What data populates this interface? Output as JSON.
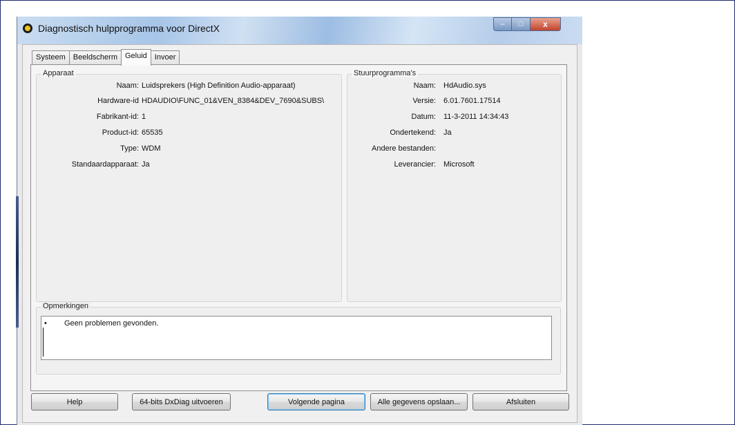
{
  "window": {
    "title": "Diagnostisch hulpprogramma voor DirectX",
    "caption_min": "–",
    "caption_max": "□",
    "caption_close": "x"
  },
  "tabs": [
    "Systeem",
    "Beeldscherm",
    "Geluid",
    "Invoer"
  ],
  "active_tab": "Geluid",
  "apparaat": {
    "title": "Apparaat",
    "rows": [
      {
        "label": "Naam:",
        "value": "Luidsprekers (High Definition Audio-apparaat)"
      },
      {
        "label": "Hardware-id",
        "value": "HDAUDIO\\FUNC_01&VEN_8384&DEV_7690&SUBS\\"
      },
      {
        "label": "Fabrikant-id:",
        "value": "1"
      },
      {
        "label": "Product-id:",
        "value": "65535"
      },
      {
        "label": "Type:",
        "value": "WDM"
      },
      {
        "label": "Standaardapparaat:",
        "value": "Ja"
      }
    ]
  },
  "stuurprogrammas": {
    "title": "Stuurprogramma's",
    "rows": [
      {
        "label": "Naam:",
        "value": "HdAudio.sys"
      },
      {
        "label": "Versie:",
        "value": "6.01.7601.17514"
      },
      {
        "label": "Datum:",
        "value": "11-3-2011 14:34:43"
      },
      {
        "label": "Ondertekend:",
        "value": "Ja"
      },
      {
        "label": "Andere bestanden:",
        "value": ""
      },
      {
        "label": "Leverancier:",
        "value": "Microsoft"
      }
    ]
  },
  "opmerkingen": {
    "title": "Opmerkingen",
    "bullet": "•",
    "items": [
      "Geen problemen gevonden."
    ]
  },
  "buttons": {
    "help": "Help",
    "dxdiag64": "64-bits DxDiag uitvoeren",
    "next_page": "Volgende pagina",
    "save_all": "Alle gegevens opslaan...",
    "close": "Afsluiten"
  }
}
